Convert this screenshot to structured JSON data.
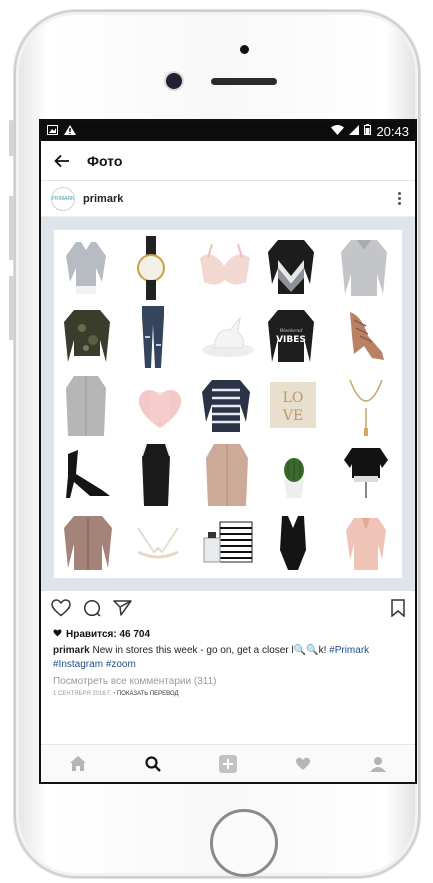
{
  "statusbar": {
    "time": "20:43"
  },
  "appbar": {
    "title": "Фото"
  },
  "post": {
    "avatar_text": "PRIMARK",
    "username": "primark",
    "likes": "Нравится: 46 704",
    "caption_user": "primark",
    "caption_text": "New in stores this week - go on, get a closer l",
    "caption_emoji": "🔍🔍",
    "caption_k": "k!",
    "tag1": "#Primark",
    "tag2": "#Instagram",
    "tag3": "#zoom",
    "comments": "Посмотреть все комментарии (311)",
    "date": "1 СЕНТЯБРЯ 2016 Г.",
    "separator": " • ",
    "translate": "ПОКАЗАТЬ ПЕРЕВОД"
  },
  "photo_items": [
    "grey-sweater",
    "watch",
    "pink-bra",
    "chevron-sweater",
    "grey-shirt",
    "camo-sweater",
    "ripped-jeans",
    "unicorn-dish",
    "vibes-sweatshirt",
    "tan-heels",
    "grey-coat",
    "heart-candle",
    "striped-top",
    "love-cushion",
    "necklace",
    "black-sandals",
    "slip-dress",
    "trench-coat",
    "cactus-pot",
    "crop-top",
    "bomber-jacket",
    "lace-bralette",
    "perfume-box",
    "bodysuit",
    "pink-blouse"
  ],
  "photo_text": {
    "vibes": "VIBES",
    "love_top": "LO",
    "love_bottom": "VE"
  },
  "colors": {
    "accent_link": "#1f4f8a",
    "status_bg": "#0d0d0d",
    "photo_frame": "#dfe3ea"
  }
}
